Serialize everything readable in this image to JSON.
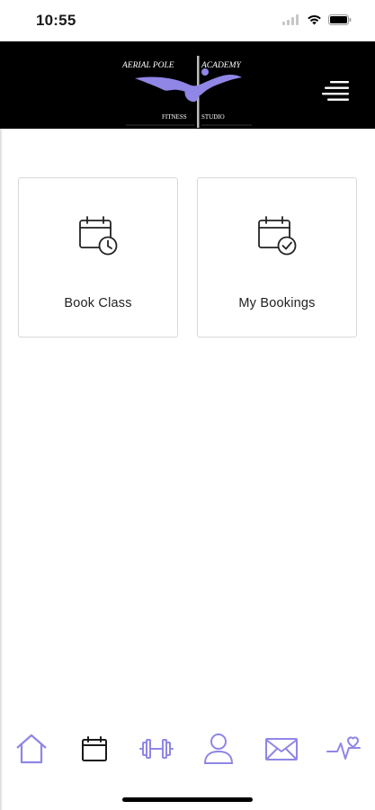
{
  "status": {
    "time": "10:55",
    "icons": [
      "signal-icon",
      "wifi-icon",
      "battery-icon"
    ]
  },
  "header": {
    "logo": {
      "text_top_left": "AERIAL POLE",
      "text_top_right": "ACADEMY",
      "text_bottom_left": "FITNESS",
      "text_bottom_right": "STUDIO"
    },
    "menu_icon": "hamburger-menu-icon"
  },
  "tiles": [
    {
      "label": "Book Class",
      "icon": "calendar-clock-icon"
    },
    {
      "label": "My Bookings",
      "icon": "calendar-check-icon"
    }
  ],
  "tab_bar": {
    "items": [
      {
        "name": "home",
        "icon": "home-icon",
        "active": true
      },
      {
        "name": "calendar",
        "icon": "calendar-icon",
        "active": false
      },
      {
        "name": "fitness",
        "icon": "dumbbell-icon",
        "active": false
      },
      {
        "name": "profile",
        "icon": "user-icon",
        "active": false
      },
      {
        "name": "messages",
        "icon": "envelope-icon",
        "active": false
      },
      {
        "name": "health",
        "icon": "heartbeat-icon",
        "active": false
      }
    ]
  },
  "colors": {
    "accent": "#8f86e6",
    "header_bg": "#000000",
    "tile_border": "#d9d9d9"
  }
}
